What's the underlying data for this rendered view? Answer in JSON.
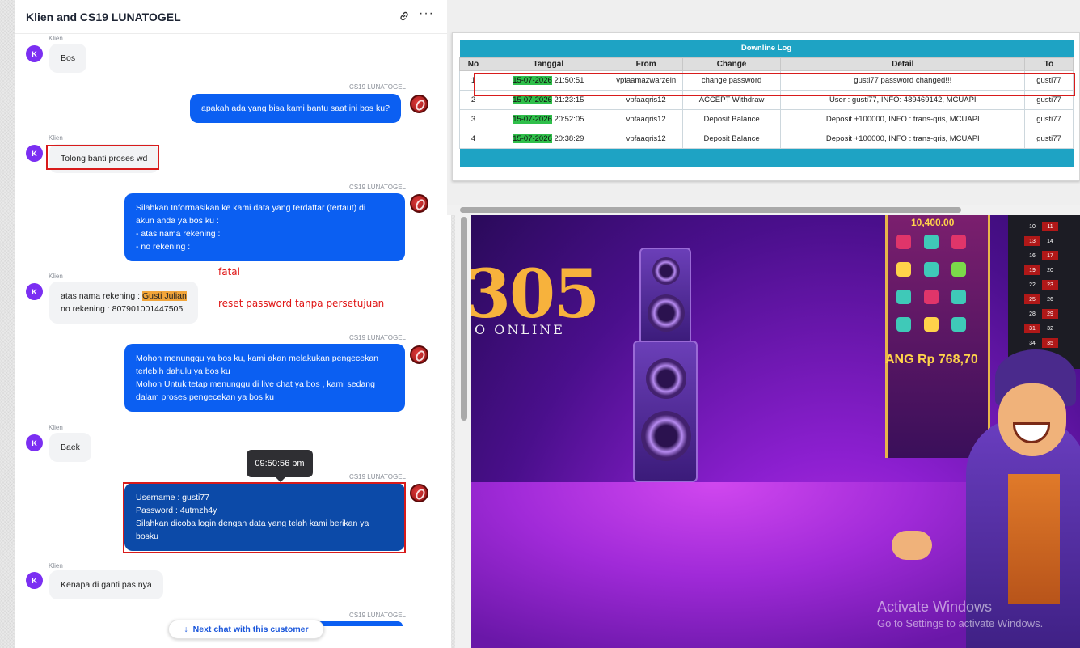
{
  "chat": {
    "title": "Klien and CS19 LUNATOGEL",
    "client_label": "Klien",
    "agent_label": "CS19 LUNATOGEL",
    "client_initial": "K",
    "messages": [
      {
        "from": "client",
        "text": "Bos"
      },
      {
        "from": "agent",
        "text": "apakah ada yang bisa kami bantu saat ini bos ku?"
      },
      {
        "from": "client",
        "text": "Tolong banti proses wd"
      },
      {
        "from": "agent",
        "text": "Silahkan Informasikan ke kami data yang terdaftar (tertaut) di\nakun anda ya bos ku :\n- atas nama rekening :\n- no rekening :"
      },
      {
        "from": "client",
        "text_before": "atas nama rekening : ",
        "highlight": "Gusti Julian",
        "text_after": "no rekening : 807901001447505"
      },
      {
        "from": "agent",
        "text": "Mohon menunggu ya bos ku, kami akan melakukan pengecekan\nterlebih dahulu ya bos ku\nMohon Untuk tetap menunggu di live chat ya bos , kami sedang\ndalam proses pengecekan ya bos ku"
      },
      {
        "from": "client",
        "text": "Baek"
      },
      {
        "from": "agent",
        "text": "Username : gusti77\nPassword : 4utmzh4y\nSilahkan dicoba login dengan data yang telah kami berikan ya\nbosku"
      },
      {
        "from": "client",
        "text": "Kenapa di ganti pas nya"
      }
    ],
    "tooltip_time": "09:50:56 pm",
    "hash_mark": "#",
    "next_chat_button": "Next chat with this customer"
  },
  "annotations": {
    "note1": "fatal",
    "note2": "reset password tanpa persetujuan"
  },
  "downline_log": {
    "title": "Downline Log",
    "columns": [
      "No",
      "Tanggal",
      "From",
      "Change",
      "Detail",
      "To"
    ],
    "rows": [
      {
        "no": "1",
        "date": "15-07-2026",
        "time": "21:50:51",
        "from": "vpfaamazwarzein",
        "change": "change password",
        "detail": "gusti77 password changed!!!",
        "to": "gusti77"
      },
      {
        "no": "2",
        "date": "15-07-2026",
        "time": "21:23:15",
        "from": "vpfaaqris12",
        "change": "ACCEPT Withdraw",
        "detail": "User : gusti77, INFO: 489469142, MCUAPI",
        "to": "gusti77"
      },
      {
        "no": "3",
        "date": "15-07-2026",
        "time": "20:52:05",
        "from": "vpfaaqris12",
        "change": "Deposit Balance",
        "detail": "Deposit +100000, INFO : trans-qris, MCUAPI",
        "to": "gusti77"
      },
      {
        "no": "4",
        "date": "15-07-2026",
        "time": "20:38:29",
        "from": "vpfaaqris12",
        "change": "Deposit Balance",
        "detail": "Deposit +100000, INFO : trans-qris, MCUAPI",
        "to": "gusti77"
      }
    ]
  },
  "casino": {
    "brand": "305",
    "subtitle": "O ONLINE",
    "slot_top": "10,400.00",
    "slot_prize": "ANG Rp 768,70",
    "roulette": [
      "10",
      "11",
      "13",
      "14",
      "16",
      "17",
      "19",
      "20",
      "22",
      "23",
      "25",
      "26",
      "28",
      "29",
      "31",
      "32",
      "34",
      "35"
    ]
  },
  "watermark": {
    "title": "Activate Windows",
    "subtitle": "Go to Settings to activate Windows."
  },
  "colors": {
    "agent_bubble": "#0b5ff2",
    "agent_bubble_dark": "#0c4aa8",
    "client_avatar": "#7b2ff2",
    "table_header": "#1ea3c4",
    "date_highlight": "#2fbf4a",
    "annotation_red": "#d81b1b"
  }
}
